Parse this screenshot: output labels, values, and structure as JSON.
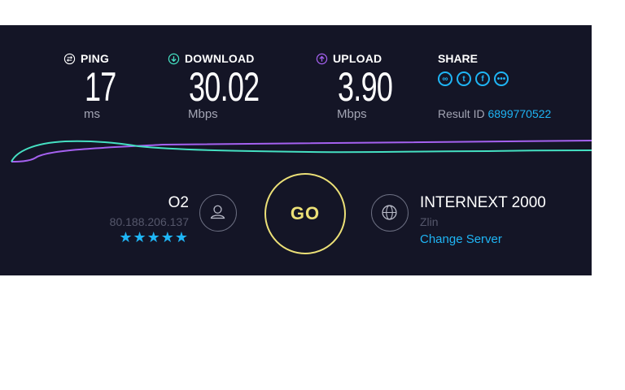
{
  "metrics": {
    "ping": {
      "label": "PING",
      "value": "17",
      "unit": "ms"
    },
    "download": {
      "label": "DOWNLOAD",
      "value": "30.02",
      "unit": "Mbps"
    },
    "upload": {
      "label": "UPLOAD",
      "value": "3.90",
      "unit": "Mbps"
    }
  },
  "share": {
    "label": "SHARE",
    "icons": [
      "link-icon",
      "twitter-icon",
      "facebook-icon",
      "more-icon"
    ],
    "result_label": "Result ID",
    "result_id": "6899770522"
  },
  "isp": {
    "name": "O2",
    "ip": "80.188.206.137",
    "stars": "★★★★★"
  },
  "go_button": {
    "label": "GO"
  },
  "server": {
    "name": "INTERNEXT 2000",
    "location": "Zlin",
    "change_label": "Change Server"
  },
  "colors": {
    "background": "#141526",
    "accent_blue": "#1fb5f5",
    "download_teal": "#45e0c2",
    "upload_purple": "#a561f0",
    "go_yellow": "#ece077"
  }
}
